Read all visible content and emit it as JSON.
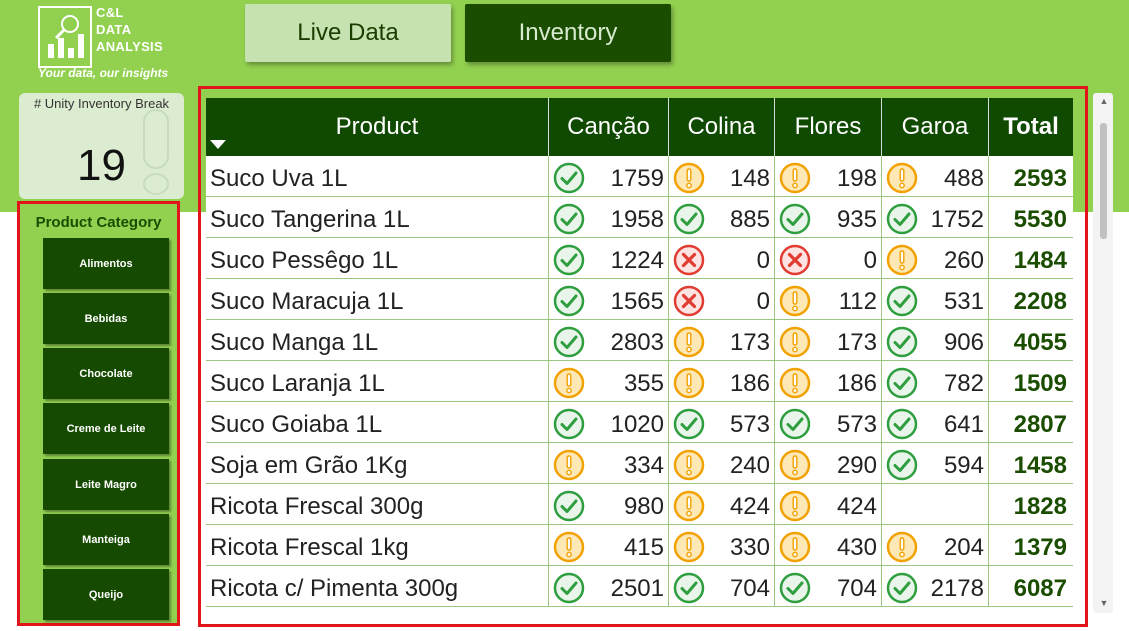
{
  "logo": {
    "line1": "C&L",
    "line2": "DATA",
    "line3": "ANALYSIS",
    "slogan": "Your data, our insights"
  },
  "nav": {
    "tabs": [
      {
        "label": "Live Data"
      },
      {
        "label": "Inventory"
      }
    ]
  },
  "kpi": {
    "title": "# Unity Inventory Break",
    "value": "19"
  },
  "slicer": {
    "title": "Product Category",
    "items": [
      "Alimentos",
      "Bebidas",
      "Chocolate",
      "Creme de Leite",
      "Leite Magro",
      "Manteiga",
      "Queijo"
    ]
  },
  "matrix": {
    "headers": [
      "Product",
      "Canção",
      "Colina",
      "Flores",
      "Garoa",
      "Total"
    ],
    "rows": [
      {
        "product": "Suco Uva 1L",
        "cells": [
          {
            "status": "ok",
            "value": "1759"
          },
          {
            "status": "warning",
            "value": "148"
          },
          {
            "status": "warning",
            "value": "198"
          },
          {
            "status": "warning",
            "value": "488"
          }
        ],
        "total": "2593"
      },
      {
        "product": "Suco Tangerina 1L",
        "cells": [
          {
            "status": "ok",
            "value": "1958"
          },
          {
            "status": "ok",
            "value": "885"
          },
          {
            "status": "ok",
            "value": "935"
          },
          {
            "status": "ok",
            "value": "1752"
          }
        ],
        "total": "5530"
      },
      {
        "product": "Suco Pessêgo 1L",
        "cells": [
          {
            "status": "ok",
            "value": "1224"
          },
          {
            "status": "error",
            "value": "0"
          },
          {
            "status": "error",
            "value": "0"
          },
          {
            "status": "warning",
            "value": "260"
          }
        ],
        "total": "1484"
      },
      {
        "product": "Suco Maracuja 1L",
        "cells": [
          {
            "status": "ok",
            "value": "1565"
          },
          {
            "status": "error",
            "value": "0"
          },
          {
            "status": "warning",
            "value": "112"
          },
          {
            "status": "ok",
            "value": "531"
          }
        ],
        "total": "2208"
      },
      {
        "product": "Suco Manga 1L",
        "cells": [
          {
            "status": "ok",
            "value": "2803"
          },
          {
            "status": "warning",
            "value": "173"
          },
          {
            "status": "warning",
            "value": "173"
          },
          {
            "status": "ok",
            "value": "906"
          }
        ],
        "total": "4055"
      },
      {
        "product": "Suco Laranja 1L",
        "cells": [
          {
            "status": "warning",
            "value": "355"
          },
          {
            "status": "warning",
            "value": "186"
          },
          {
            "status": "warning",
            "value": "186"
          },
          {
            "status": "ok",
            "value": "782"
          }
        ],
        "total": "1509"
      },
      {
        "product": "Suco Goiaba 1L",
        "cells": [
          {
            "status": "ok",
            "value": "1020"
          },
          {
            "status": "ok",
            "value": "573"
          },
          {
            "status": "ok",
            "value": "573"
          },
          {
            "status": "ok",
            "value": "641"
          }
        ],
        "total": "2807"
      },
      {
        "product": "Soja em Grão 1Kg",
        "cells": [
          {
            "status": "warning",
            "value": "334"
          },
          {
            "status": "warning",
            "value": "240"
          },
          {
            "status": "warning",
            "value": "290"
          },
          {
            "status": "ok",
            "value": "594"
          }
        ],
        "total": "1458"
      },
      {
        "product": "Ricota Frescal 300g",
        "cells": [
          {
            "status": "ok",
            "value": "980"
          },
          {
            "status": "warning",
            "value": "424"
          },
          {
            "status": "warning",
            "value": "424"
          },
          {
            "status": "none",
            "value": ""
          }
        ],
        "total": "1828"
      },
      {
        "product": "Ricota Frescal 1kg",
        "cells": [
          {
            "status": "warning",
            "value": "415"
          },
          {
            "status": "warning",
            "value": "330"
          },
          {
            "status": "warning",
            "value": "430"
          },
          {
            "status": "warning",
            "value": "204"
          }
        ],
        "total": "1379"
      },
      {
        "product": "Ricota c/ Pimenta 300g",
        "cells": [
          {
            "status": "ok",
            "value": "2501"
          },
          {
            "status": "ok",
            "value": "704"
          },
          {
            "status": "ok",
            "value": "704"
          },
          {
            "status": "ok",
            "value": "2178"
          }
        ],
        "total": "6087"
      }
    ]
  },
  "colors": {
    "ok": "#2e9e3f",
    "warning": "#f2a200",
    "error": "#e03c31",
    "header": "#0f4a00",
    "band": "#92d050",
    "highlight_border": "#e0161b"
  },
  "icons": {
    "ok": "check-circle-icon",
    "warning": "exclamation-circle-icon",
    "error": "x-circle-icon"
  }
}
